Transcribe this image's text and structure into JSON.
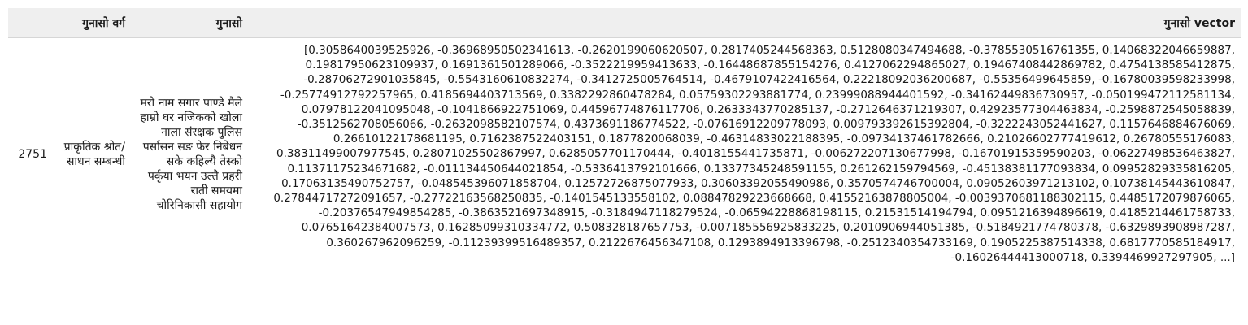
{
  "table": {
    "headers": {
      "index": "",
      "category": "गुनासो वर्ग",
      "text": "गुनासो",
      "vector": "गुनासो vector"
    },
    "rows": [
      {
        "index": "2751",
        "category": "प्राकृतिक श्रोत/ साधन सम्बन्धी",
        "text": "मरो नाम सगार पाण्डे मैले हाम्रो घर नजिकको खोला नाला संरक्षक पुलिस पर्सासन सङ फेर निबेधन सके कहिल्यै तेस्को पर्कृया भयन उल्तै प्रहरी राती समयमा चोरिनिकासी सहायोग",
        "vector": "[0.3058640039525926, -0.3696895050234161​3, -0.2620199060620507, 0.2817405244568363, 0.5128080347494688, -0.3785530516761355, 0.14068322046659887, 0.19817950623109937, 0.1691361501289066, -0.3522219959413633, -0.16448687855154276, 0.4127062294865027, 0.19467408442869782, 0.4754138585412875, -0.28706272901035845, -0.5543160610832274, -0.3412725005764514, -0.4679107422416564, 0.22218092036200687, -0.55356499645859, -0.16780039598233998, -0.25774912792257965, 0.4185694403713569, 0.3382292860478284, 0.05759302293881774, 0.23999088944401592, -0.34162449836730957, -0.050199472112581134, 0.07978122041095048, -0.1041866922751069, 0.44596774876117706, 0.2633343770285137, -0.2712646371219307, 0.42923577304463834, -0.2598872545058839, -0.3512562708056066, -0.2632098582107574, 0.4373691186774522, -0.07616912209778093, 0.009793392615392804, -0.3222243052441627, 0.1157646884676069, 0.26610122178681195, 0.7162387522403151, 0.1877820068039, -0.46314833022188395, -0.09734137461782666, 0.21026602777419612, 0.26780555176083, 0.38311499007977545, 0.28071025502867997, 0.6285057701170444, -0.4018155441735871, -0.006272207130677998, -0.16701915359590203, -0.06227498536463827, 0.11371175234671682, -0.011134450644021854, -0.5336413792101666, 0.13377345248591155, 0.261262159794569, -0.45138381177093834, 0.09952829335816205, 0.17063135490752757, -0.048545396071858704, 0.12572726875077933, 0.30603392055490986, 0.3570574746700004, 0.09052603971213102, 0.10738145443610847, 0.27844717272091657, -0.27722163568250835, -0.1401545133558102, 0.08847829223668668, 0.41552163878805004, -0.0039370681188302115, 0.4485172079876065, -0.20376547949854285, -0.3863521697348915, -0.3184947118279524, -0.06594228868198115, 0.21531514194794, 0.0951216394896619, 0.4185214461758733, 0.07651642384007573, 0.16285099310334772, 0.508328187657753, -0.007185556925833225, 0.2010906944051385, -0.5184921774780378, -0.6329893908987287, 0.360267962096259, -0.11239399516489357, 0.2122676456347108, 0.1293894913396798, -0.2512340354733169, 0.1905225387514338, 0.6817770585184917, -0.16026444413000718, 0.3394469927297905, ...]"
      }
    ]
  }
}
